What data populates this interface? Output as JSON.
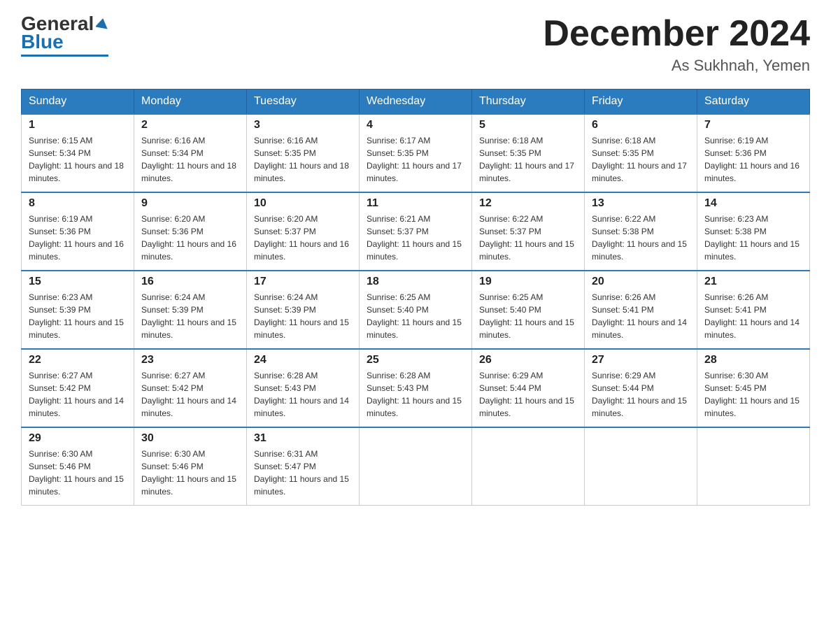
{
  "logo": {
    "general": "General",
    "blue": "Blue"
  },
  "title": "December 2024",
  "subtitle": "As Sukhnah, Yemen",
  "days_of_week": [
    "Sunday",
    "Monday",
    "Tuesday",
    "Wednesday",
    "Thursday",
    "Friday",
    "Saturday"
  ],
  "weeks": [
    [
      {
        "day": "1",
        "sunrise": "6:15 AM",
        "sunset": "5:34 PM",
        "daylight": "11 hours and 18 minutes."
      },
      {
        "day": "2",
        "sunrise": "6:16 AM",
        "sunset": "5:34 PM",
        "daylight": "11 hours and 18 minutes."
      },
      {
        "day": "3",
        "sunrise": "6:16 AM",
        "sunset": "5:35 PM",
        "daylight": "11 hours and 18 minutes."
      },
      {
        "day": "4",
        "sunrise": "6:17 AM",
        "sunset": "5:35 PM",
        "daylight": "11 hours and 17 minutes."
      },
      {
        "day": "5",
        "sunrise": "6:18 AM",
        "sunset": "5:35 PM",
        "daylight": "11 hours and 17 minutes."
      },
      {
        "day": "6",
        "sunrise": "6:18 AM",
        "sunset": "5:35 PM",
        "daylight": "11 hours and 17 minutes."
      },
      {
        "day": "7",
        "sunrise": "6:19 AM",
        "sunset": "5:36 PM",
        "daylight": "11 hours and 16 minutes."
      }
    ],
    [
      {
        "day": "8",
        "sunrise": "6:19 AM",
        "sunset": "5:36 PM",
        "daylight": "11 hours and 16 minutes."
      },
      {
        "day": "9",
        "sunrise": "6:20 AM",
        "sunset": "5:36 PM",
        "daylight": "11 hours and 16 minutes."
      },
      {
        "day": "10",
        "sunrise": "6:20 AM",
        "sunset": "5:37 PM",
        "daylight": "11 hours and 16 minutes."
      },
      {
        "day": "11",
        "sunrise": "6:21 AM",
        "sunset": "5:37 PM",
        "daylight": "11 hours and 15 minutes."
      },
      {
        "day": "12",
        "sunrise": "6:22 AM",
        "sunset": "5:37 PM",
        "daylight": "11 hours and 15 minutes."
      },
      {
        "day": "13",
        "sunrise": "6:22 AM",
        "sunset": "5:38 PM",
        "daylight": "11 hours and 15 minutes."
      },
      {
        "day": "14",
        "sunrise": "6:23 AM",
        "sunset": "5:38 PM",
        "daylight": "11 hours and 15 minutes."
      }
    ],
    [
      {
        "day": "15",
        "sunrise": "6:23 AM",
        "sunset": "5:39 PM",
        "daylight": "11 hours and 15 minutes."
      },
      {
        "day": "16",
        "sunrise": "6:24 AM",
        "sunset": "5:39 PM",
        "daylight": "11 hours and 15 minutes."
      },
      {
        "day": "17",
        "sunrise": "6:24 AM",
        "sunset": "5:39 PM",
        "daylight": "11 hours and 15 minutes."
      },
      {
        "day": "18",
        "sunrise": "6:25 AM",
        "sunset": "5:40 PM",
        "daylight": "11 hours and 15 minutes."
      },
      {
        "day": "19",
        "sunrise": "6:25 AM",
        "sunset": "5:40 PM",
        "daylight": "11 hours and 15 minutes."
      },
      {
        "day": "20",
        "sunrise": "6:26 AM",
        "sunset": "5:41 PM",
        "daylight": "11 hours and 14 minutes."
      },
      {
        "day": "21",
        "sunrise": "6:26 AM",
        "sunset": "5:41 PM",
        "daylight": "11 hours and 14 minutes."
      }
    ],
    [
      {
        "day": "22",
        "sunrise": "6:27 AM",
        "sunset": "5:42 PM",
        "daylight": "11 hours and 14 minutes."
      },
      {
        "day": "23",
        "sunrise": "6:27 AM",
        "sunset": "5:42 PM",
        "daylight": "11 hours and 14 minutes."
      },
      {
        "day": "24",
        "sunrise": "6:28 AM",
        "sunset": "5:43 PM",
        "daylight": "11 hours and 14 minutes."
      },
      {
        "day": "25",
        "sunrise": "6:28 AM",
        "sunset": "5:43 PM",
        "daylight": "11 hours and 15 minutes."
      },
      {
        "day": "26",
        "sunrise": "6:29 AM",
        "sunset": "5:44 PM",
        "daylight": "11 hours and 15 minutes."
      },
      {
        "day": "27",
        "sunrise": "6:29 AM",
        "sunset": "5:44 PM",
        "daylight": "11 hours and 15 minutes."
      },
      {
        "day": "28",
        "sunrise": "6:30 AM",
        "sunset": "5:45 PM",
        "daylight": "11 hours and 15 minutes."
      }
    ],
    [
      {
        "day": "29",
        "sunrise": "6:30 AM",
        "sunset": "5:46 PM",
        "daylight": "11 hours and 15 minutes."
      },
      {
        "day": "30",
        "sunrise": "6:30 AM",
        "sunset": "5:46 PM",
        "daylight": "11 hours and 15 minutes."
      },
      {
        "day": "31",
        "sunrise": "6:31 AM",
        "sunset": "5:47 PM",
        "daylight": "11 hours and 15 minutes."
      },
      null,
      null,
      null,
      null
    ]
  ]
}
